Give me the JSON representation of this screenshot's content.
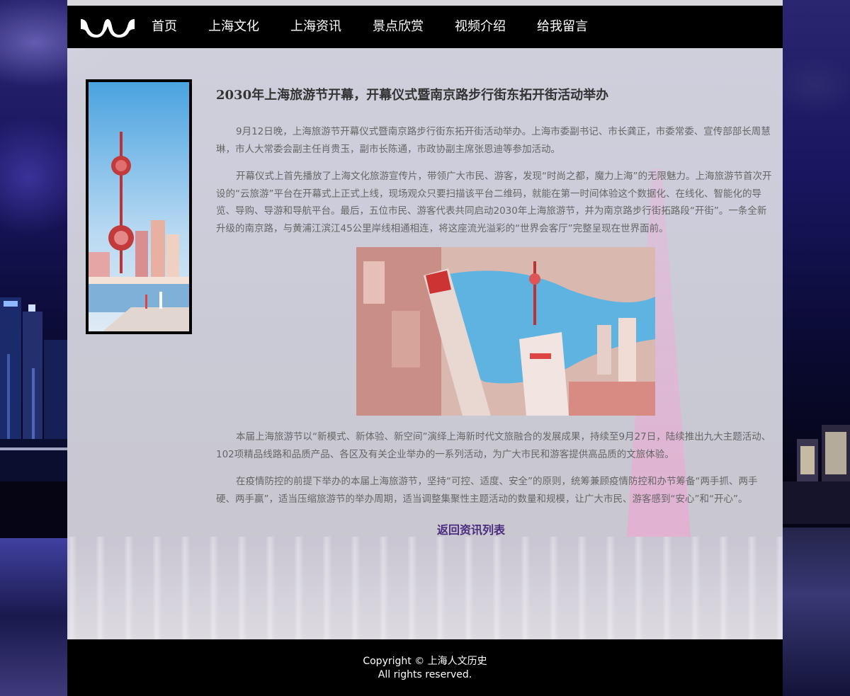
{
  "nav": {
    "items": [
      {
        "label": "首页"
      },
      {
        "label": "上海文化"
      },
      {
        "label": "上海资讯"
      },
      {
        "label": "景点欣赏"
      },
      {
        "label": "视频介绍"
      },
      {
        "label": "给我留言"
      }
    ]
  },
  "article": {
    "title": "2030年上海旅游节开幕，开幕仪式暨南京路步行街东拓开街活动举办",
    "paragraphs": [
      "9月12日晚，上海旅游节开幕仪式暨南京路步行街东拓开街活动举办。上海市委副书记、市长龚正，市委常委、宣传部部长周慧琳，市人大常委会副主任肖贵玉，副市长陈通，市政协副主席张恩迪等参加活动。",
      "开幕仪式上首先播放了上海文化旅游宣传片，带领广大市民、游客，发现“时尚之都，魔力上海”的无限魅力。上海旅游节首次开设的“云旅游”平台在开幕式上正式上线，现场观众只要扫描该平台二维码，就能在第一时间体验这个数据化、在线化、智能化的导览、导购、导游和导航平台。最后，五位市民、游客代表共同启动2030年上海旅游节，并为南京路步行街拓路段“开街”。一条全新升级的南京路，与黄浦江滨江45公里岸线相通相连，将这座流光溢彩的“世界会客厅”完整呈现在世界面前。",
      "本届上海旅游节以“新模式、新体验、新空间”演绎上海新时代文旅融合的发展成果，持续至9月27日，陆续推出九大主题活动、102项精品线路和品质产品、各区及有关企业举办的一系列活动，为广大市民和游客提供高品质的文旅体验。",
      "在疫情防控的前提下举办的本届上海旅游节，坚持“可控、适度、安全”的原则，统筹兼顾疫情防控和办节筹备“两手抓、两手硬、两手赢”，适当压缩旅游节的举办周期，适当调整集聚性主题活动的数量和规模，让广大市民、游客感到“安心”和“开心”。"
    ],
    "back_link": "返回资讯列表"
  },
  "footer": {
    "copyright": "Copyright © 上海人文历史",
    "rights": "All rights reserved."
  },
  "colors": {
    "header_bg": "#000000",
    "link": "#4b2d7f",
    "text": "#666666",
    "title": "#333333"
  }
}
